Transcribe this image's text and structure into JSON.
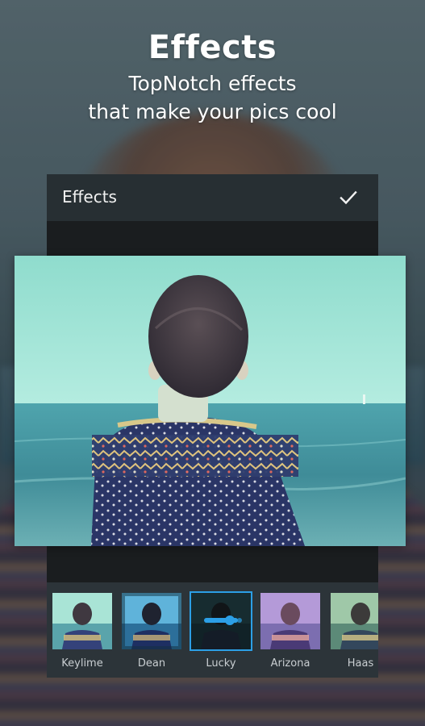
{
  "promo": {
    "title": "Effects",
    "subtitle_line1": "TopNotch effects",
    "subtitle_line2": "that make your pics cool"
  },
  "toolbar": {
    "title": "Effects",
    "apply_icon": "check-icon"
  },
  "effects": [
    {
      "label": "Keylime",
      "selected": false
    },
    {
      "label": "Dean",
      "selected": false
    },
    {
      "label": "Lucky",
      "selected": true,
      "slider_icon": "adjust-slider-icon"
    },
    {
      "label": "Arizona",
      "selected": false
    },
    {
      "label": "Haas",
      "selected": false
    }
  ],
  "colors": {
    "accent": "#2c9fe6",
    "toolbar_bg": "#272f33",
    "strip_bg": "#2c3439",
    "frame_bg": "#1a1d1f"
  }
}
